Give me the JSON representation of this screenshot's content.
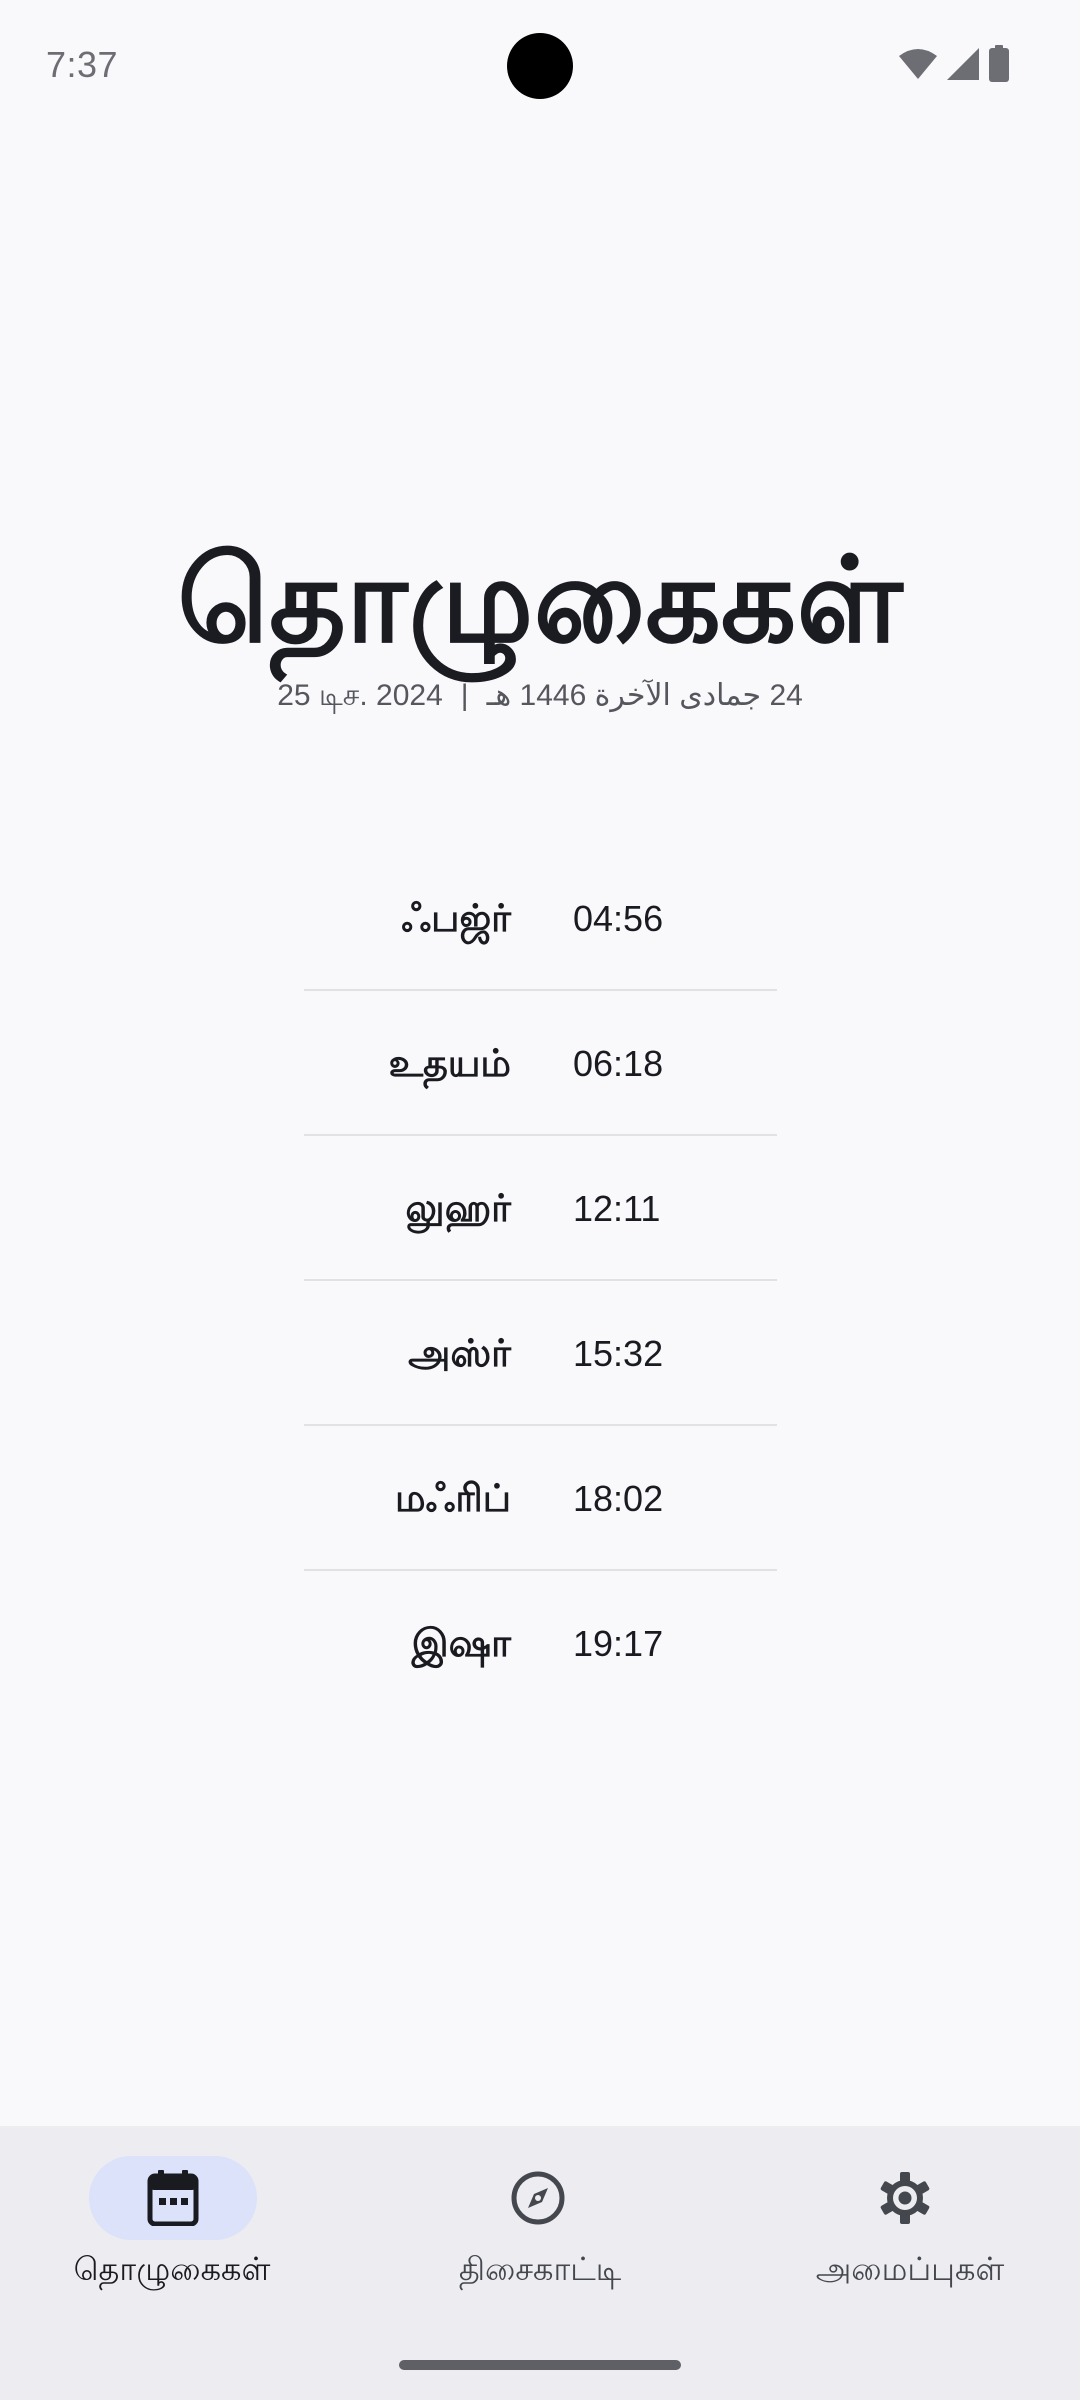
{
  "status_bar": {
    "time": "7:37",
    "icons": [
      "wifi-icon",
      "signal-icon",
      "battery-icon"
    ]
  },
  "header": {
    "title": "தொழுகைகள்",
    "gregorian_date": "25 டிச. 2024",
    "separator": "|",
    "hijri_date": "24 جمادى الآخرة 1446 هـ"
  },
  "prayers": [
    {
      "name": "ஃபஜ்ர்",
      "time": "04:56"
    },
    {
      "name": "உதயம்",
      "time": "06:18"
    },
    {
      "name": "லுஹர்",
      "time": "12:11"
    },
    {
      "name": "அஸ்ர்",
      "time": "15:32"
    },
    {
      "name": "மஃரிப்",
      "time": "18:02"
    },
    {
      "name": "இஷா",
      "time": "19:17"
    }
  ],
  "bottom_nav": {
    "items": [
      {
        "label": "தொழுகைகள்",
        "icon": "calendar-icon",
        "active": true
      },
      {
        "label": "திசைகாட்டி",
        "icon": "compass-icon",
        "active": false
      },
      {
        "label": "அமைப்புகள்",
        "icon": "gear-icon",
        "active": false
      }
    ]
  },
  "colors": {
    "background": "#f9f9fc",
    "nav_background": "#ececf1",
    "active_indicator": "#dbe2f9",
    "text_primary": "#1a1b20",
    "divider": "#e1e2e6"
  }
}
